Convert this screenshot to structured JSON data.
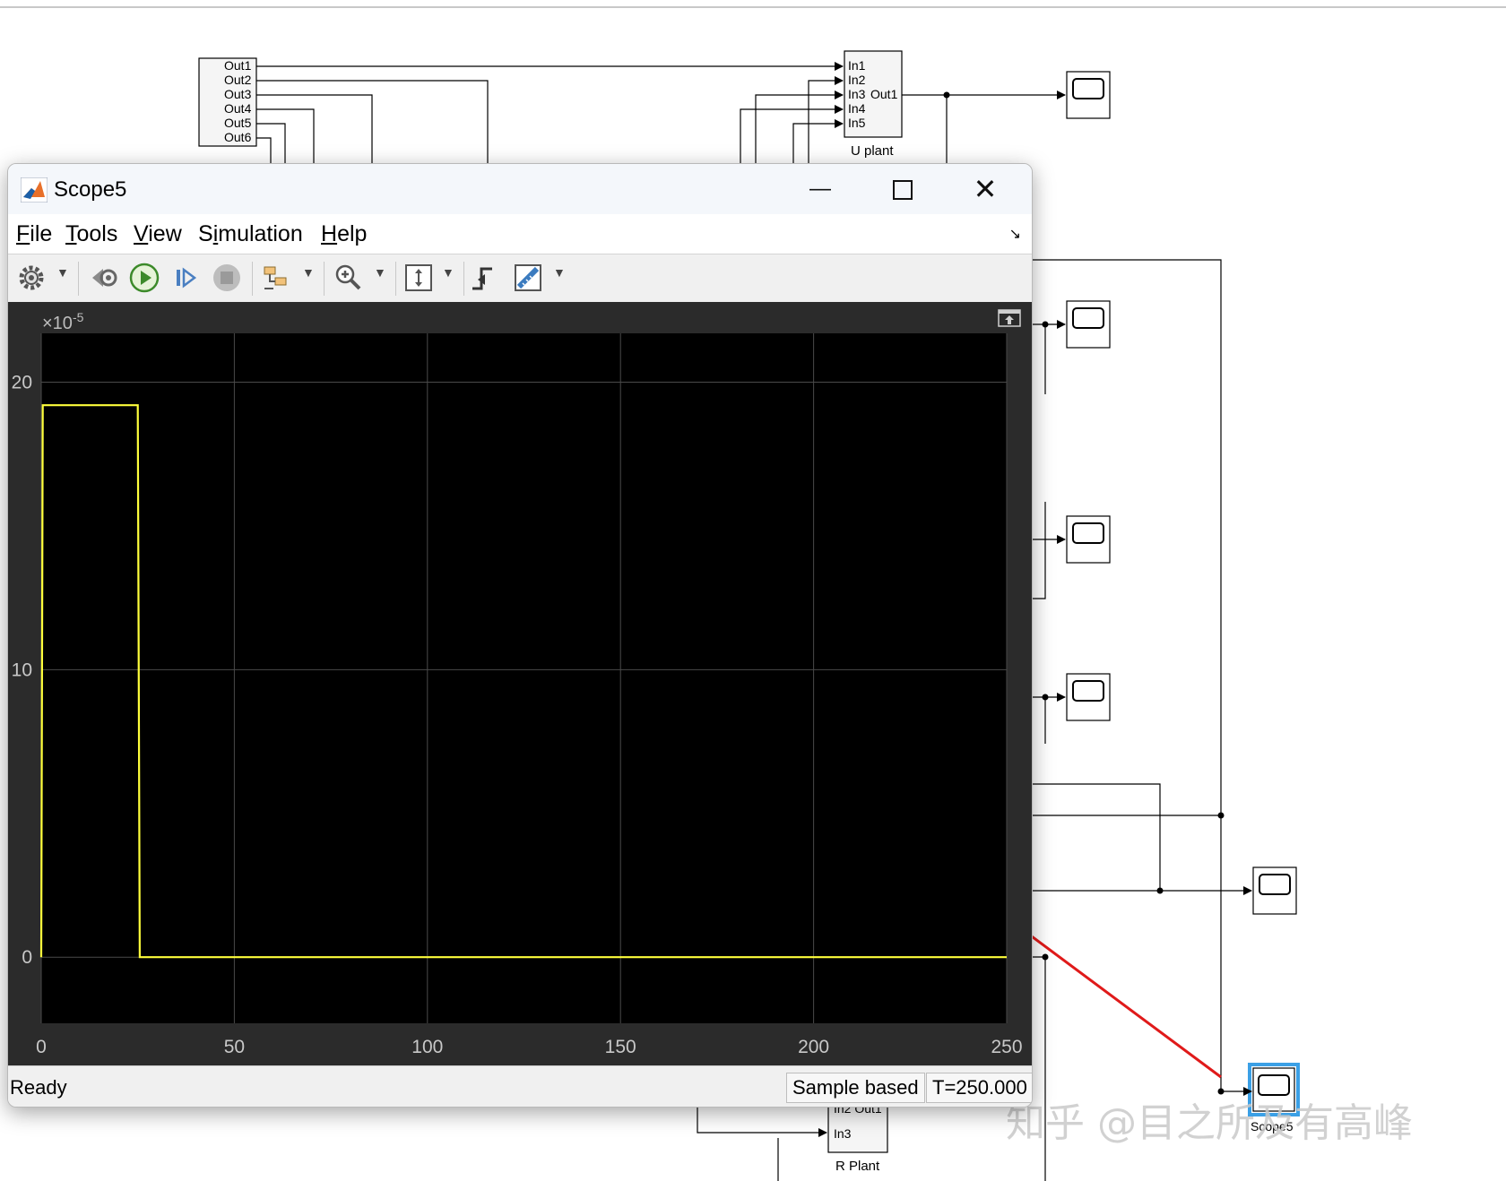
{
  "window": {
    "title": "Scope5",
    "menu": [
      "File",
      "Tools",
      "View",
      "Simulation",
      "Help"
    ],
    "menu_mnemonics": [
      "F",
      "T",
      "V",
      "i",
      "H"
    ],
    "status": "Ready",
    "sample_mode": "Sample based",
    "time": "T=250.000"
  },
  "toolbar_icons": [
    "gear-icon",
    "step-back-icon",
    "run-icon",
    "step-forward-icon",
    "stop-icon",
    "signal-select-icon",
    "zoom-in-icon",
    "autoscale-icon",
    "triggers-icon",
    "measurements-icon"
  ],
  "diagram": {
    "source_block_ports": [
      "Out1",
      "Out2",
      "Out3",
      "Out4",
      "Out5",
      "Out6"
    ],
    "u_plant": {
      "name": "U plant",
      "inputs": [
        "In1",
        "In2",
        "In3",
        "In4",
        "In5"
      ],
      "output": "Out1"
    },
    "r_plant": {
      "name": "R Plant",
      "ports": [
        "In2 Out1",
        "In3"
      ]
    },
    "scope_label": "Scope5",
    "watermark": "知乎 @目之所及有高峰"
  },
  "colors": {
    "plot_bg": "#000000",
    "frame_bg": "#2b2b2b",
    "trace": "#ffff3b",
    "grid": "#4a4a4a",
    "annotation_arrow": "#e01a1a"
  },
  "chart_data": {
    "type": "line",
    "title": "",
    "xlabel": "",
    "ylabel": "",
    "y_exponent_label": "×10",
    "y_exponent_power": "-5",
    "xlim": [
      0,
      250
    ],
    "ylim": [
      -2.3,
      21.7
    ],
    "x_ticks": [
      "0",
      "50",
      "100",
      "150",
      "200",
      "250"
    ],
    "x_tick_values": [
      0,
      50,
      100,
      150,
      200,
      250
    ],
    "y_ticks": [
      "0",
      "10",
      "20"
    ],
    "y_tick_values": [
      0,
      10,
      20
    ],
    "grid": true,
    "series": [
      {
        "x": [
          0,
          0.4,
          25,
          25.5,
          250
        ],
        "y": [
          0,
          19.2,
          19.2,
          0,
          0
        ]
      }
    ]
  }
}
